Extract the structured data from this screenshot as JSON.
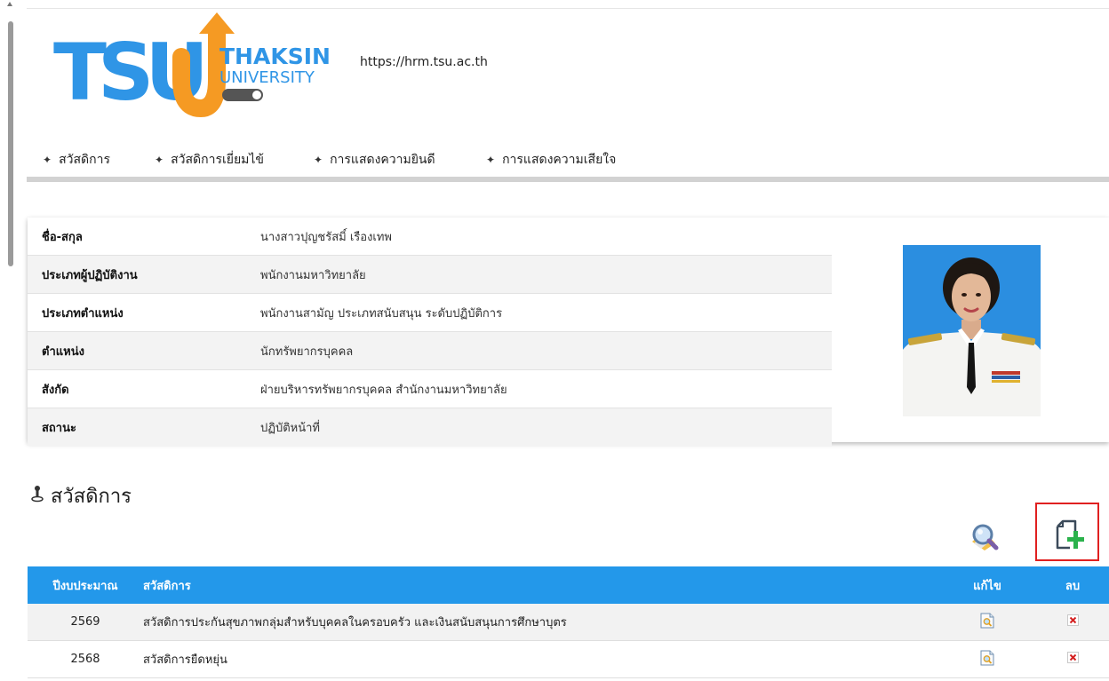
{
  "site": {
    "logo_text": "TSU",
    "logo_brand_line1": "THAKSIN",
    "logo_brand_line2": "UNIVERSITY",
    "url": "https://hrm.tsu.ac.th"
  },
  "nav": {
    "items": [
      {
        "label": "สวัสดิการ"
      },
      {
        "label": "สวัสดิการเยี่ยมไข้"
      },
      {
        "label": "การแสดงความยินดี"
      },
      {
        "label": "การแสดงความเสียใจ"
      }
    ]
  },
  "profile": {
    "rows": [
      {
        "label": "ชื่อ-สกุล",
        "value": "นางสาวปุญชรัสมิ์ เรืองเทพ"
      },
      {
        "label": "ประเภทผู้ปฏิบัติงาน",
        "value": "พนักงานมหาวิทยาลัย"
      },
      {
        "label": "ประเภทตำแหน่ง",
        "value": "พนักงานสามัญ ประเภทสนับสนุน ระดับปฏิบัติการ"
      },
      {
        "label": "ตำแหน่ง",
        "value": "นักทรัพยากรบุคคล"
      },
      {
        "label": "สังกัด",
        "value": "ฝ่ายบริหารทรัพยากรบุคคล สำนักงานมหาวิทยาลัย"
      },
      {
        "label": "สถานะ",
        "value": "ปฏิบัติหน้าที่"
      }
    ]
  },
  "section": {
    "title": "สวัสดิการ",
    "pin_icon": "pin-icon"
  },
  "table": {
    "headers": {
      "year": "ปีงบประมาณ",
      "name": "สวัสดิการ",
      "edit": "แก้ไข",
      "delete": "ลบ"
    },
    "rows": [
      {
        "year": "2569",
        "name": "สวัสดิการประกันสุขภาพกลุ่มสำหรับบุคคลในครอบครัว และเงินสนับสนุนการศึกษาบุตร"
      },
      {
        "year": "2568",
        "name": "สวัสดิการยืดหยุ่น"
      }
    ]
  },
  "colors": {
    "table_header": "#2398ea",
    "logo_blue": "#2f95e6",
    "logo_orange": "#f59a23",
    "highlight_border": "#e02020"
  }
}
